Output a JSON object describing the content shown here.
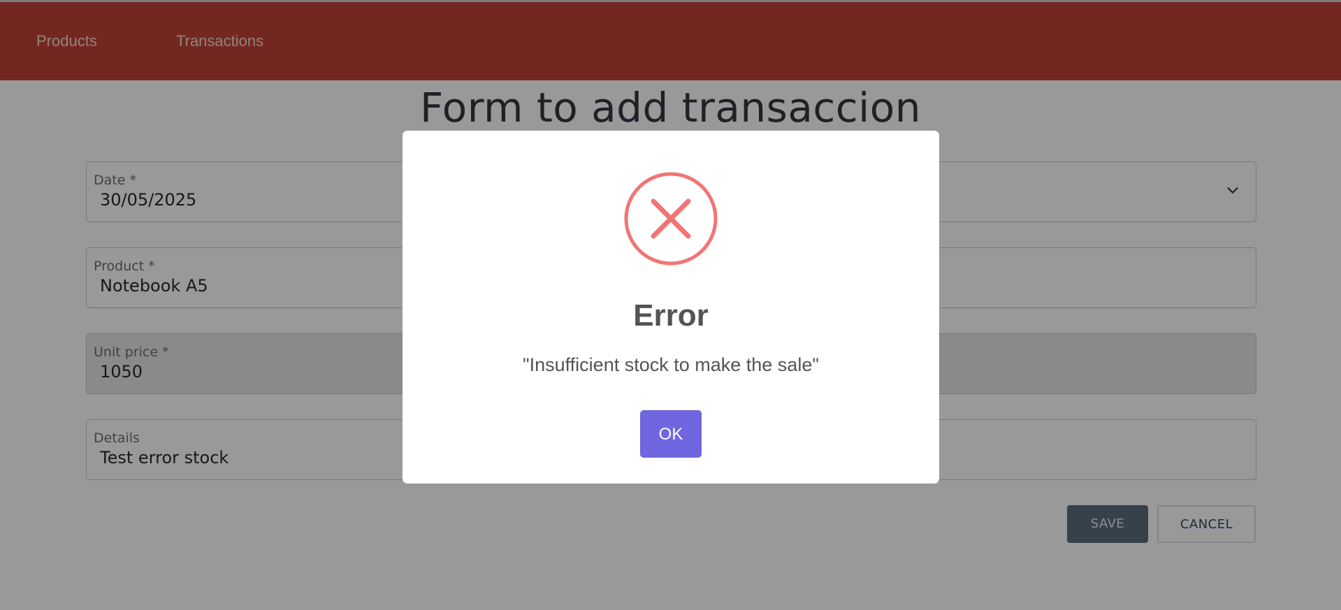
{
  "colors": {
    "navbar": "#c14238",
    "modal_confirm": "#7066e0",
    "error_icon": "#f27474",
    "overlay": "rgba(0,0,0,0.4)"
  },
  "nav": {
    "items": [
      {
        "label": "Products"
      },
      {
        "label": "Transactions"
      }
    ]
  },
  "page": {
    "title": "Form to add transaccion"
  },
  "form": {
    "date": {
      "label": "Date *",
      "value": "30/05/2025"
    },
    "product": {
      "label": "Product *",
      "value": "Notebook A5"
    },
    "unit_price": {
      "label": "Unit price *",
      "value": "1050"
    },
    "details": {
      "label": "Details",
      "value": "Test error stock"
    },
    "save_label": "SAVE",
    "cancel_label": "CANCEL"
  },
  "modal": {
    "icon": "error-x-circle-icon",
    "title": "Error",
    "message": "\"Insufficient stock to make the sale\"",
    "confirm_label": "OK"
  }
}
